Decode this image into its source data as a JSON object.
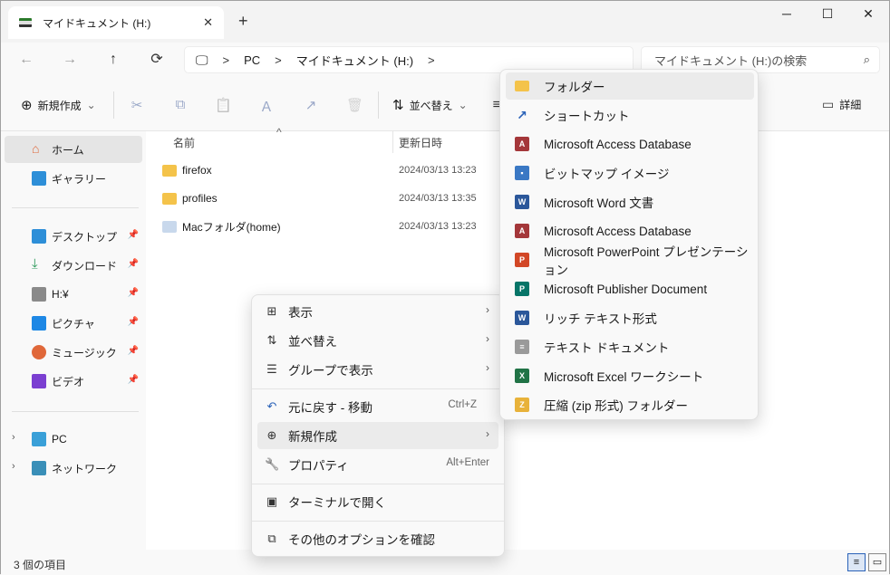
{
  "tab": {
    "title": "マイドキュメント (H:)",
    "close": "✕",
    "new": "+"
  },
  "window_controls": {
    "min": "─",
    "max": "☐",
    "close": "✕"
  },
  "nav": {
    "back": "←",
    "forward": "→",
    "up": "↑",
    "refresh": "⟳"
  },
  "address": {
    "pc_icon": "🖵",
    "sep": ">",
    "segments": [
      "PC",
      "マイドキュメント (H:)"
    ],
    "tail": ">"
  },
  "search": {
    "placeholder": "マイドキュメント (H:)の検索",
    "icon": "⌕"
  },
  "toolbar": {
    "new_label": "新規作成",
    "sort_label": "並べ替え",
    "details_label": "詳細",
    "icons": {
      "cut": "✂",
      "copy": "⧉",
      "paste": "📋",
      "rename": "Ａ",
      "share": "↗",
      "delete": "🗑",
      "sort": "⇅",
      "view": "≡",
      "details": "▭",
      "new": "⊕",
      "dropdown": "⌄"
    }
  },
  "sidebar": {
    "home": "ホーム",
    "gallery": "ギャラリー",
    "pinned": [
      {
        "label": "デスクトップ",
        "color": "#2e8fd8"
      },
      {
        "label": "ダウンロード",
        "color": "#2c9a5a"
      },
      {
        "label": "H:¥",
        "color": "#8a8a8a"
      },
      {
        "label": "ピクチャ",
        "color": "#1e88e5"
      },
      {
        "label": "ミュージック",
        "color": "#e0683a"
      },
      {
        "label": "ビデオ",
        "color": "#7b3fd1"
      }
    ],
    "pin": "📌",
    "pc": "PC",
    "network": "ネットワーク",
    "chevron": "›"
  },
  "columns": {
    "name": "名前",
    "modified": "更新日時",
    "sort_indicator": "^"
  },
  "files": [
    {
      "name": "firefox",
      "date": "2024/03/13 13:23"
    },
    {
      "name": "profiles",
      "date": "2024/03/13 13:35"
    },
    {
      "name": "Macフォルダ(home)",
      "date": "2024/03/13 13:23"
    }
  ],
  "status": {
    "count": "3 個の項目"
  },
  "context_menu": {
    "items": [
      {
        "label": "表示",
        "icon": "⊞",
        "arrow": "›"
      },
      {
        "label": "並べ替え",
        "icon": "⇅",
        "arrow": "›"
      },
      {
        "label": "グループで表示",
        "icon": "☰",
        "arrow": "›"
      },
      {
        "label": "元に戻す - 移動",
        "icon": "↶",
        "shortcut": "Ctrl+Z"
      },
      {
        "label": "新規作成",
        "icon": "⊕",
        "arrow": "›"
      },
      {
        "label": "プロパティ",
        "icon": "🔧",
        "shortcut": "Alt+Enter"
      },
      {
        "label": "ターミナルで開く",
        "icon": "▣"
      },
      {
        "label": "その他のオプションを確認",
        "icon": "⧉"
      }
    ]
  },
  "submenu": {
    "items": [
      {
        "label": "フォルダー",
        "icon_color": "#f4c34a",
        "icon_text": ""
      },
      {
        "label": "ショートカット",
        "icon_color": "#ffffff",
        "icon_text": "↗"
      },
      {
        "label": "Microsoft Access Database",
        "icon_color": "#a4373a",
        "icon_text": "A"
      },
      {
        "label": "ビットマップ イメージ",
        "icon_color": "#3a78c4",
        "icon_text": "▪"
      },
      {
        "label": "Microsoft Word 文書",
        "icon_color": "#2b579a",
        "icon_text": "W"
      },
      {
        "label": "Microsoft Access Database",
        "icon_color": "#a4373a",
        "icon_text": "A"
      },
      {
        "label": "Microsoft PowerPoint プレゼンテーション",
        "icon_color": "#d24726",
        "icon_text": "P"
      },
      {
        "label": "Microsoft Publisher Document",
        "icon_color": "#077568",
        "icon_text": "P"
      },
      {
        "label": "リッチ テキスト形式",
        "icon_color": "#2b579a",
        "icon_text": "W"
      },
      {
        "label": "テキスト ドキュメント",
        "icon_color": "#9a9a9a",
        "icon_text": "≡"
      },
      {
        "label": "Microsoft Excel ワークシート",
        "icon_color": "#217346",
        "icon_text": "X"
      },
      {
        "label": "圧縮 (zip 形式) フォルダー",
        "icon_color": "#e8b23a",
        "icon_text": "Z"
      }
    ]
  }
}
